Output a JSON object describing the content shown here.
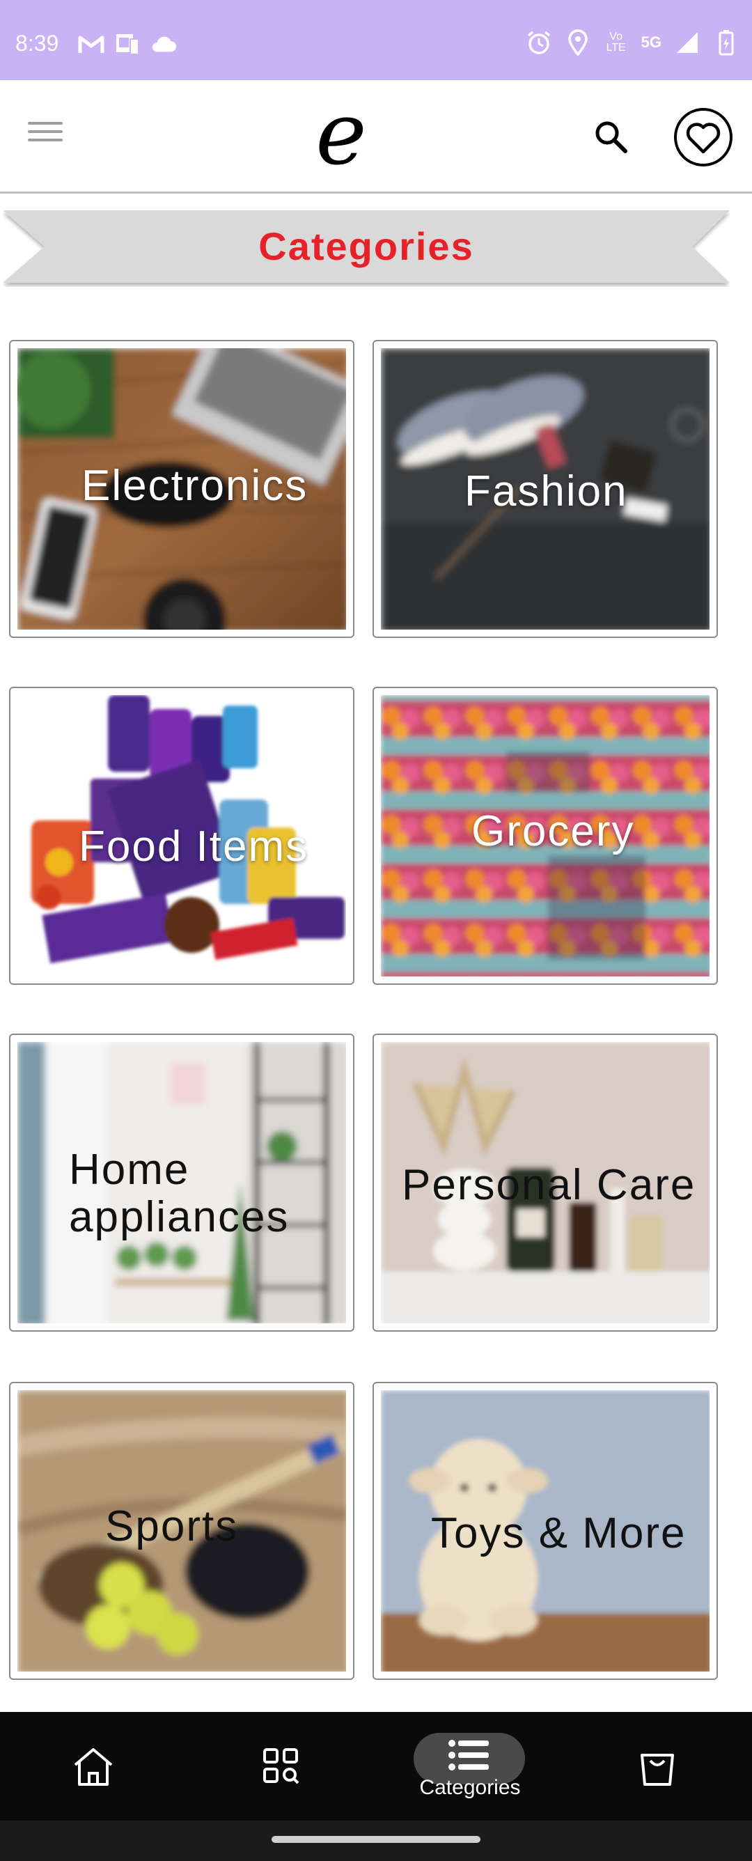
{
  "status_bar": {
    "time": "8:39",
    "left_icons": [
      "gmail-icon",
      "device-icon",
      "cloud-icon"
    ],
    "right_icons": [
      "alarm-icon",
      "location-icon",
      "volte-icon",
      "5g-icon",
      "signal-icon",
      "battery-icon"
    ],
    "volte_text": "Vo LTE",
    "network_text": "5G"
  },
  "header": {
    "logo_text": "e",
    "menu_icon": "hamburger-icon",
    "search_icon": "search-icon",
    "wishlist_icon": "heart-icon"
  },
  "banner": {
    "title": "Categories",
    "title_color": "#e6212a"
  },
  "categories": [
    {
      "label": "Electronics"
    },
    {
      "label": "Fashion"
    },
    {
      "label": "Food Items"
    },
    {
      "label": "Grocery"
    },
    {
      "label": "Home appliances"
    },
    {
      "label": "Personal Care"
    },
    {
      "label": "Sports"
    },
    {
      "label": "Toys & More"
    }
  ],
  "bottom_nav": {
    "items": [
      {
        "icon": "home-icon"
      },
      {
        "icon": "grid-search-icon"
      },
      {
        "icon": "list-icon",
        "label": "Categories",
        "active": true
      },
      {
        "icon": "shopping-bag-icon"
      }
    ]
  },
  "colors": {
    "status_bar": "#c9b3f5",
    "accent": "#e6212a",
    "nav_background": "#0a0a0a"
  }
}
